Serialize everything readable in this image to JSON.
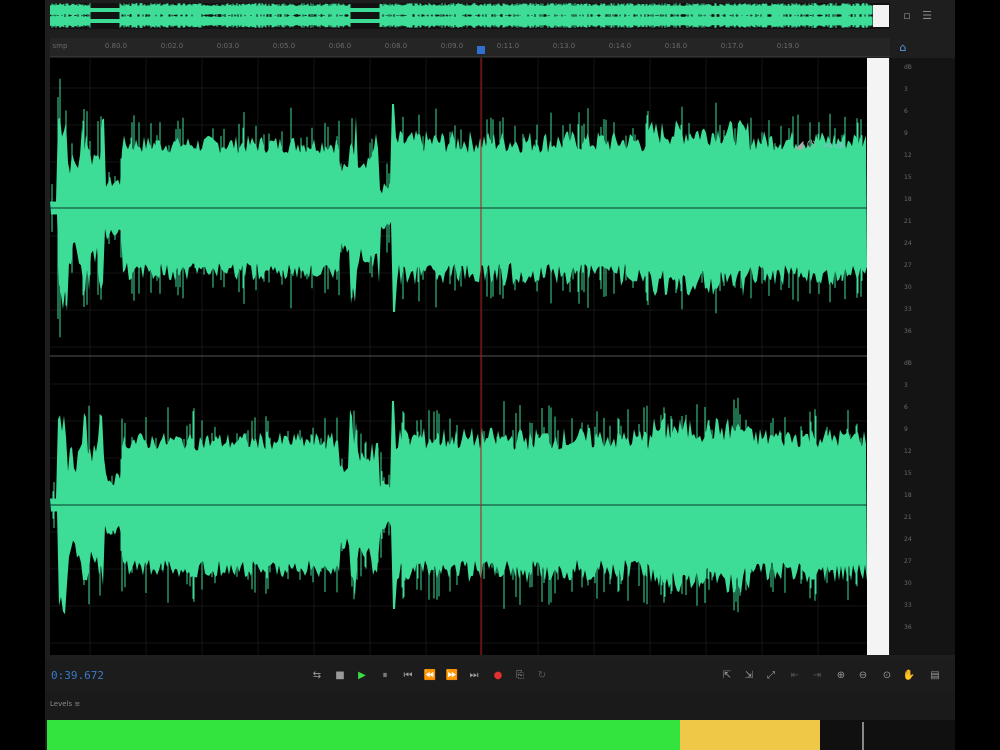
{
  "ruler": {
    "labels": [
      "smp",
      "0.80.0",
      "0:02.0",
      "0:03.0",
      "0:05.0",
      "0:06.0",
      "0:08.0",
      "0:09.0",
      "0:11.0",
      "0:13.0",
      "0:14.0",
      "0:16.0",
      "0:17.0",
      "0:19.0"
    ]
  },
  "hud": {
    "pct": "+0 dB"
  },
  "db_scale": [
    "dB",
    "3",
    "6",
    "9",
    "12",
    "15",
    "18",
    "21",
    "24",
    "27",
    "30",
    "33",
    "36"
  ],
  "transport": {
    "timecode": "0:39.672"
  },
  "levels": {
    "title": "Levels",
    "title_mark": "≡"
  },
  "colors": {
    "waveform": "#3ddc97",
    "meter_green": "#33e43f",
    "meter_yellow": "#f0c848",
    "timecode": "#3b78c9",
    "playhead": "#b01818"
  },
  "meter": {
    "left_level": 0.85,
    "peak_level": 0.9
  }
}
